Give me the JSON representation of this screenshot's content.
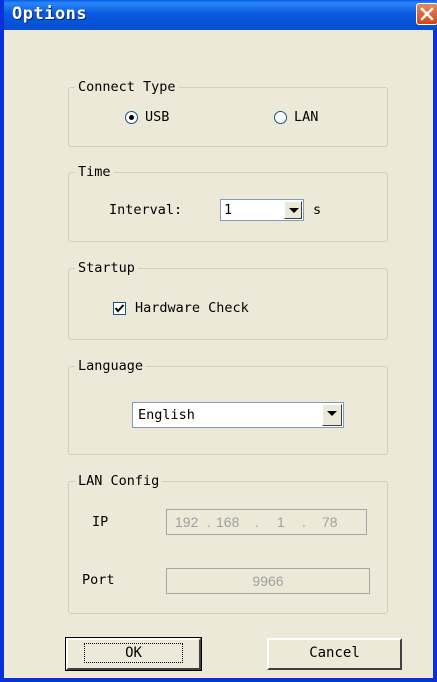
{
  "window": {
    "title": "Options"
  },
  "connect_type": {
    "legend": "Connect Type",
    "options": [
      {
        "label": "USB",
        "selected": true
      },
      {
        "label": "LAN",
        "selected": false
      }
    ]
  },
  "time": {
    "legend": "Time",
    "interval_label": "Interval:",
    "interval_value": "1",
    "unit": "s"
  },
  "startup": {
    "legend": "Startup",
    "hardware_check_label": "Hardware Check",
    "hardware_check_checked": true
  },
  "language": {
    "legend": "Language",
    "selected": "English"
  },
  "lan_config": {
    "legend": "LAN Config",
    "ip_label": "IP",
    "ip_octets": [
      "192",
      "168",
      "1",
      "78"
    ],
    "port_label": "Port",
    "port_value": "9966",
    "enabled": false
  },
  "buttons": {
    "ok": "OK",
    "cancel": "Cancel"
  },
  "colors": {
    "titlebar": "#0653d6",
    "close": "#d2451b",
    "dialog_bg": "#ece9d8"
  }
}
